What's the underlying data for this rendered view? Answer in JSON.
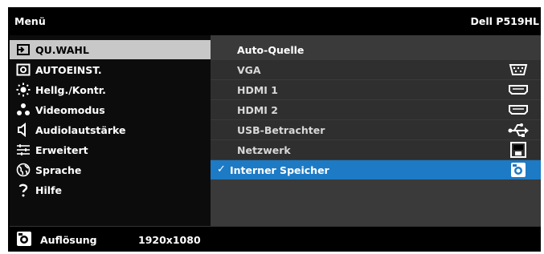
{
  "header": {
    "title": "Menü",
    "model": "Dell P519HL"
  },
  "menu": [
    {
      "label": "QU.WAHL",
      "icon": "input-source-icon",
      "selected": true
    },
    {
      "label": "AUTOEINST.",
      "icon": "auto-adjust-icon"
    },
    {
      "label": "Hellg./Kontr.",
      "icon": "brightness-icon"
    },
    {
      "label": "Videomodus",
      "icon": "video-mode-icon"
    },
    {
      "label": "Audiolautstärke",
      "icon": "speaker-icon"
    },
    {
      "label": "Erweitert",
      "icon": "advanced-settings-icon"
    },
    {
      "label": "Sprache",
      "icon": "language-globe-icon"
    },
    {
      "label": "Hilfe",
      "icon": "help-icon"
    }
  ],
  "submenu": {
    "header": "Auto-Quelle",
    "items": [
      {
        "label": "VGA",
        "icon": "vga-port-icon"
      },
      {
        "label": "HDMI 1",
        "icon": "hdmi-port-icon"
      },
      {
        "label": "HDMI 2",
        "icon": "hdmi-port-icon"
      },
      {
        "label": "USB-Betrachter",
        "icon": "usb-icon"
      },
      {
        "label": "Netzwerk",
        "icon": "network-icon"
      },
      {
        "label": "Interner Speicher",
        "icon": "internal-storage-icon",
        "checked": true,
        "check_mark": "✓"
      }
    ]
  },
  "footer": {
    "label": "Auflösung",
    "value": "1920x1080",
    "icon": "internal-storage-icon"
  },
  "colors": {
    "background": "#000000",
    "selected_menu": "#c8c8c8",
    "active_submenu": "#1d7ac5",
    "submenu_bg": "#3a3a3a"
  }
}
